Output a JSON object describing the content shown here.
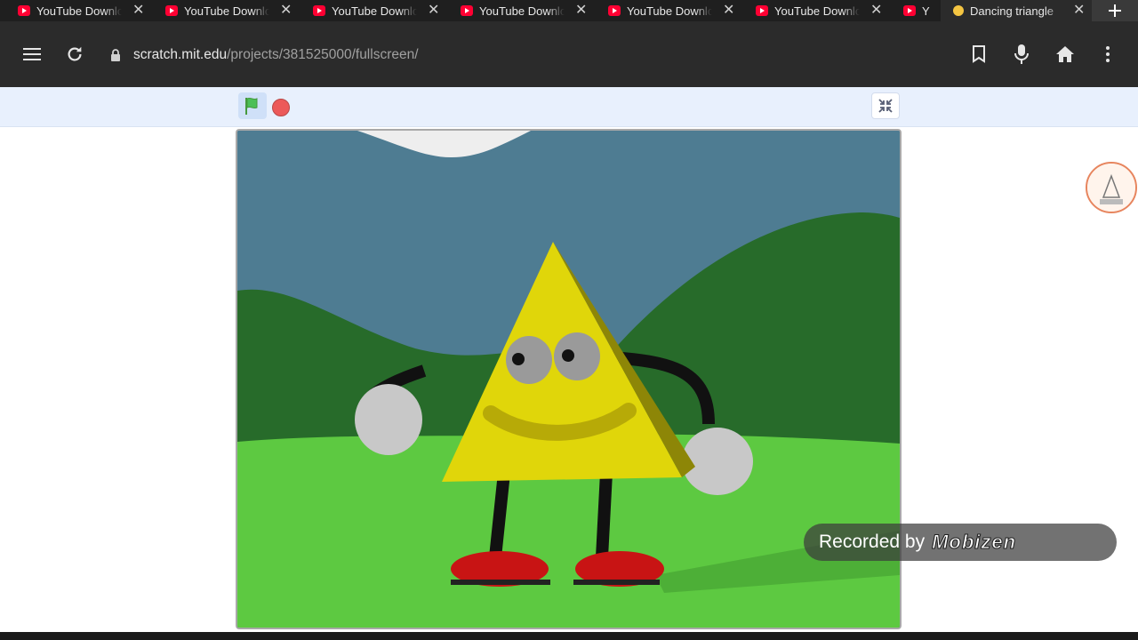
{
  "browser": {
    "tabs": [
      {
        "title": "YouTube Downlo",
        "active": false,
        "icon": "youtube-icon"
      },
      {
        "title": "YouTube Downlo",
        "active": false,
        "icon": "youtube-icon"
      },
      {
        "title": "YouTube Downlo",
        "active": false,
        "icon": "youtube-icon"
      },
      {
        "title": "YouTube Downlo",
        "active": false,
        "icon": "youtube-icon"
      },
      {
        "title": "YouTube Downlo",
        "active": false,
        "icon": "youtube-icon"
      },
      {
        "title": "YouTube Downlo",
        "active": false,
        "icon": "youtube-icon"
      },
      {
        "title": "Y",
        "active": false,
        "icon": "youtube-icon"
      },
      {
        "title": "Dancing triangle",
        "active": true,
        "icon": "scratch-icon"
      }
    ],
    "url_host": "scratch.mit.edu",
    "url_path": "/projects/381525000/fullscreen/",
    "toolbar_icons": [
      "menu-icon",
      "reload-icon",
      "lock-icon",
      "bookmark-icon",
      "mic-icon",
      "home-icon",
      "more-vert-icon"
    ]
  },
  "player": {
    "controls": [
      "green-flag-icon",
      "stop-icon",
      "exit-fullscreen-icon"
    ],
    "accent_flag": "#4cbf56",
    "accent_stop": "#ec5959"
  },
  "watermark": {
    "prefix": "Recorded by",
    "brand": "Mobizen"
  }
}
